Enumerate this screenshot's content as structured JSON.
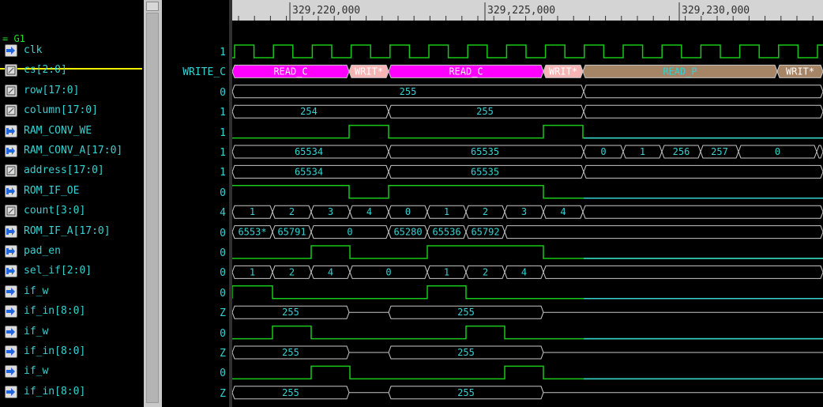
{
  "timeline": {
    "labels": [
      "329,220,000",
      "329,225,000",
      "329,230,000"
    ]
  },
  "group": "= G1",
  "signals": [
    {
      "name": "clk",
      "type": "in",
      "value": "1"
    },
    {
      "name": "cs[2:0]",
      "type": "reg",
      "value": "WRITE_C"
    },
    {
      "name": "row[17:0]",
      "type": "reg",
      "value": "0"
    },
    {
      "name": "column[17:0]",
      "type": "reg",
      "value": "1"
    },
    {
      "name": "RAM_CONV_WE",
      "type": "out",
      "value": "1"
    },
    {
      "name": "RAM_CONV_A[17:0]",
      "type": "out",
      "value": "1"
    },
    {
      "name": "address[17:0]",
      "type": "reg",
      "value": "1"
    },
    {
      "name": "ROM_IF_OE",
      "type": "out",
      "value": "0"
    },
    {
      "name": "count[3:0]",
      "type": "reg",
      "value": "4"
    },
    {
      "name": "ROM_IF_A[17:0]",
      "type": "out",
      "value": "0"
    },
    {
      "name": "pad_en",
      "type": "out",
      "value": "0"
    },
    {
      "name": "sel_if[2:0]",
      "type": "out",
      "value": "0"
    },
    {
      "name": "if_w",
      "type": "in",
      "value": "0"
    },
    {
      "name": "if_in[8:0]",
      "type": "in",
      "value": "Z"
    },
    {
      "name": "if_w",
      "type": "in",
      "value": "0"
    },
    {
      "name": "if_in[8:0]",
      "type": "in",
      "value": "Z"
    },
    {
      "name": "if_w",
      "type": "in",
      "value": "0"
    },
    {
      "name": "if_in[8:0]",
      "type": "in",
      "value": "Z"
    }
  ],
  "waves": {
    "cs": [
      {
        "label": "READ_C",
        "color": "#ff00ff",
        "text": "#ffffff"
      },
      {
        "label": "WRIT*",
        "color": "#f7b4b4",
        "text": "#ffffff"
      },
      {
        "label": "READ_C",
        "color": "#ff00ff",
        "text": "#ffffff"
      },
      {
        "label": "WRIT*",
        "color": "#f7b4b4",
        "text": "#ffffff"
      },
      {
        "label": "READ_P",
        "color": "#a68466",
        "text": "#37d2d2"
      },
      {
        "label": "WRIT*",
        "color": "#a68466",
        "text": "#ffffff"
      }
    ],
    "row": [
      "255",
      ""
    ],
    "column": [
      "254",
      "255",
      ""
    ],
    "ram_conv_a": [
      "65534",
      "65535",
      "0",
      "1",
      "256",
      "257",
      "0",
      ""
    ],
    "address": [
      "65534",
      "65535",
      ""
    ],
    "count": [
      "1",
      "2",
      "3",
      "4",
      "0",
      "1",
      "2",
      "3",
      "4",
      ""
    ],
    "rom_if_a": [
      "6553*",
      "65791",
      "0",
      "65280",
      "65536",
      "65792",
      ""
    ],
    "sel_if": [
      "1",
      "2",
      "4",
      "0",
      "1",
      "2",
      "4",
      ""
    ],
    "if_in_1": [
      "255",
      "255"
    ],
    "if_in_2": [
      "255",
      "255"
    ],
    "if_in_3": [
      "255",
      "255"
    ]
  },
  "colors": {
    "trace": "#37d2d2",
    "high": "#19c819",
    "bus": "#c8c8c8",
    "label": "#37d2d2",
    "cursor": "#f0f000"
  }
}
